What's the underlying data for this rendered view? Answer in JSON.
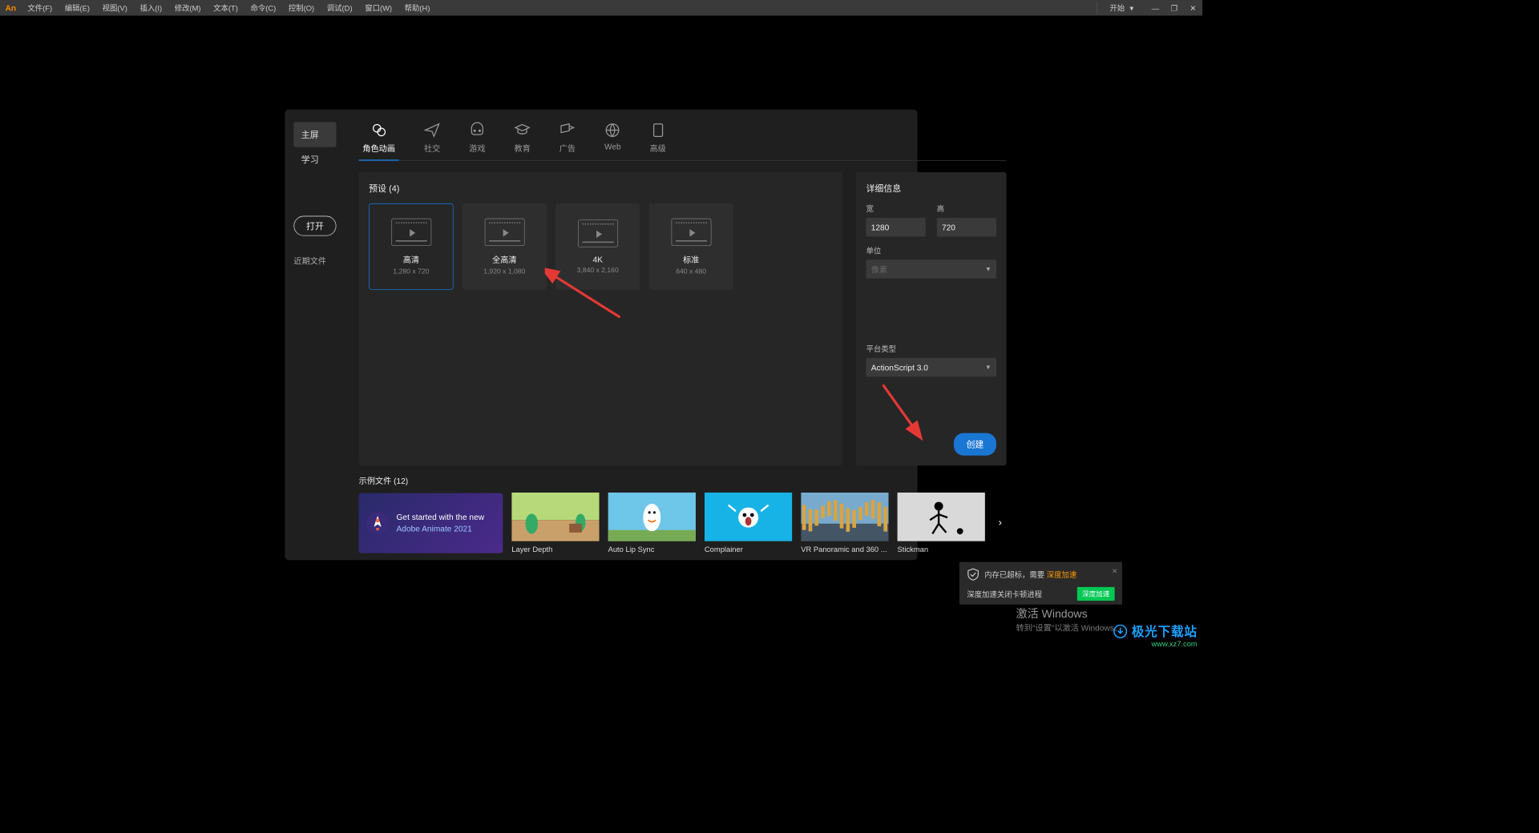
{
  "app_logo": "An",
  "menu": [
    "文件(F)",
    "编辑(E)",
    "视图(V)",
    "插入(I)",
    "修改(M)",
    "文本(T)",
    "命令(C)",
    "控制(O)",
    "调试(D)",
    "窗口(W)",
    "帮助(H)"
  ],
  "workspace": "开始",
  "sidebar": {
    "home": "主屏",
    "learn": "学习",
    "open": "打开",
    "recent": "近期文件"
  },
  "tabs": [
    {
      "label": "角色动画"
    },
    {
      "label": "社交"
    },
    {
      "label": "游戏"
    },
    {
      "label": "教育"
    },
    {
      "label": "广告"
    },
    {
      "label": "Web"
    },
    {
      "label": "高级"
    }
  ],
  "presets_heading": "预设 (4)",
  "presets": [
    {
      "name": "高清",
      "dim": "1,280 x 720",
      "selected": true
    },
    {
      "name": "全高清",
      "dim": "1,920 x 1,080"
    },
    {
      "name": "4K",
      "dim": "3,840 x 2,160"
    },
    {
      "name": "标准",
      "dim": "640 x 480"
    }
  ],
  "details": {
    "heading": "详细信息",
    "width_label": "宽",
    "width_value": "1280",
    "height_label": "高",
    "height_value": "720",
    "unit_label": "单位",
    "unit_value": "像素",
    "platform_label": "平台类型",
    "platform_value": "ActionScript 3.0",
    "create": "创建"
  },
  "samples_heading": "示例文件 (12)",
  "promo_line1": "Get started with the new",
  "promo_line2": "Adobe Animate 2021",
  "samples": [
    {
      "cap": "Layer Depth",
      "bg": "linear-gradient(#b7d97a 0 55%,#caa06a 55%)"
    },
    {
      "cap": "Auto Lip Sync",
      "bg": "linear-gradient(#6ec6e8,#6ec6e8)"
    },
    {
      "cap": "Complainer",
      "bg": "linear-gradient(#17b3e6,#17b3e6)"
    },
    {
      "cap": "VR Panoramic and 360 ...",
      "bg": "repeating-linear-gradient(90deg,#d9a441 0 6px,#6aa6d9 6px 12px)"
    },
    {
      "cap": "Stickman",
      "bg": "#d9d9d9"
    }
  ],
  "toast": {
    "msg_a": "内存已超标，需要",
    "msg_b": "深度加速",
    "sub": "深度加速关闭卡顿进程",
    "btn": "深度加速"
  },
  "activate": {
    "big": "激活 Windows",
    "sub": "转到\"设置\"以激活 Windows。"
  },
  "watermark": {
    "cn": "极光下载站",
    "url": "www.xz7.com"
  }
}
